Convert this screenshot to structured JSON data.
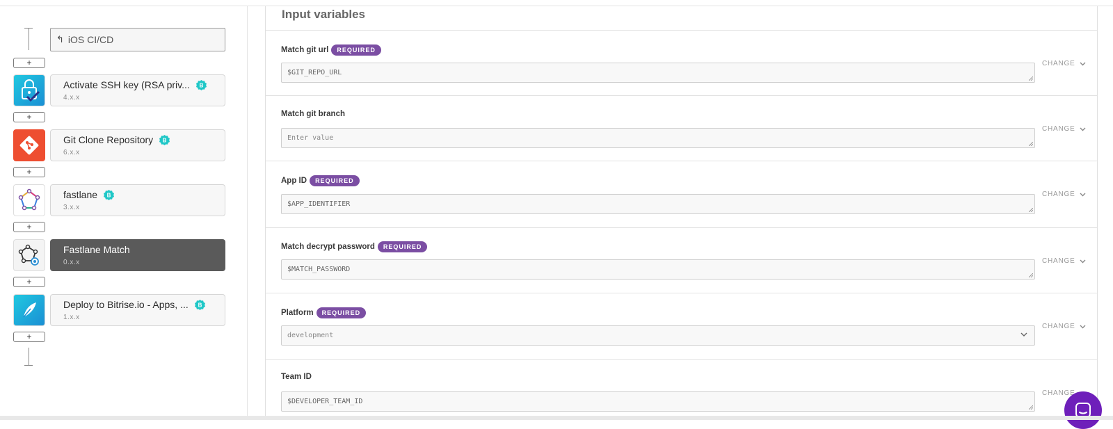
{
  "workflow": {
    "trigger_label": "iOS CI/CD",
    "steps": [
      {
        "title": "Activate SSH key (RSA priv...",
        "version": "4.x.x",
        "verified": true,
        "icon": "ssh-key-icon",
        "active": false
      },
      {
        "title": "Git Clone Repository",
        "version": "6.x.x",
        "verified": true,
        "icon": "git-clone-icon",
        "active": false
      },
      {
        "title": "fastlane",
        "version": "3.x.x",
        "verified": true,
        "icon": "fastlane-icon",
        "active": false
      },
      {
        "title": "Fastlane Match",
        "version": "0.x.x",
        "verified": false,
        "icon": "fastlane-match-icon",
        "active": true
      },
      {
        "title": "Deploy to Bitrise.io - Apps, ...",
        "version": "1.x.x",
        "verified": true,
        "icon": "bitrise-deploy-icon",
        "active": false
      }
    ],
    "add_label": "+",
    "verified_badge": "B"
  },
  "inputs": {
    "title": "Input variables",
    "required_label": "REQUIRED",
    "change_label": "CHANGE",
    "fields": [
      {
        "label": "Match git url",
        "required": true,
        "value": "$GIT_REPO_URL"
      },
      {
        "label": "Match git branch",
        "required": false,
        "placeholder": "Enter value"
      },
      {
        "label": "App ID",
        "required": true,
        "value": "$APP_IDENTIFIER"
      },
      {
        "label": "Match decrypt password",
        "required": true,
        "value": "$MATCH_PASSWORD"
      },
      {
        "label": "Platform",
        "required": true,
        "value": "development"
      },
      {
        "label": "Team ID",
        "required": false,
        "value": "$DEVELOPER_TEAM_ID"
      }
    ]
  },
  "colors": {
    "required_badge": "#7b4ea3",
    "active_step": "#5a5a5a",
    "verified_badge": "#1fc7c7",
    "chat_button": "#6e1fba"
  }
}
